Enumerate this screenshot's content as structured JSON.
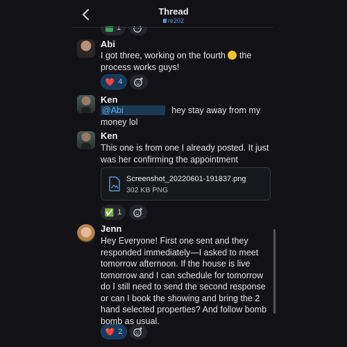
{
  "header": {
    "title": "Thread",
    "channel": "re202"
  },
  "messages": [
    {
      "author": "Abi",
      "text_before": "I got three, working on the fourth ",
      "text_after": " the process works guys!",
      "reaction": {
        "emoji": "❤️",
        "count": "4"
      }
    },
    {
      "author": "Ken",
      "mention": "@Abi",
      "text": "hey stay away from my money lol"
    },
    {
      "author": "Ken",
      "text": "This one is from one I already posted. It just was her confirming the appointment",
      "attachment": {
        "name": "Screenshot_20220601-191837.png",
        "meta": "302 KB PNG"
      },
      "reaction": {
        "emoji": "✅",
        "count": "1"
      }
    },
    {
      "author": "Jenn",
      "text": "Hey Everyone! First one sent and they responded immediately—I asked to meet tomorrow afternoon. If the house is live tomorrow  and I can schedule for tomorrow do I still need to send the second response or can I book the showing and bring the 2 hand selected properties?  And follow bomb bomb as usual.",
      "reaction": {
        "emoji": "❤️",
        "count": "2"
      }
    }
  ],
  "top_partial_reaction": {
    "count": "1"
  },
  "colors": {
    "background": "#121216",
    "accent": "#4c9bd6",
    "mention_bg": "#1d3a55"
  }
}
